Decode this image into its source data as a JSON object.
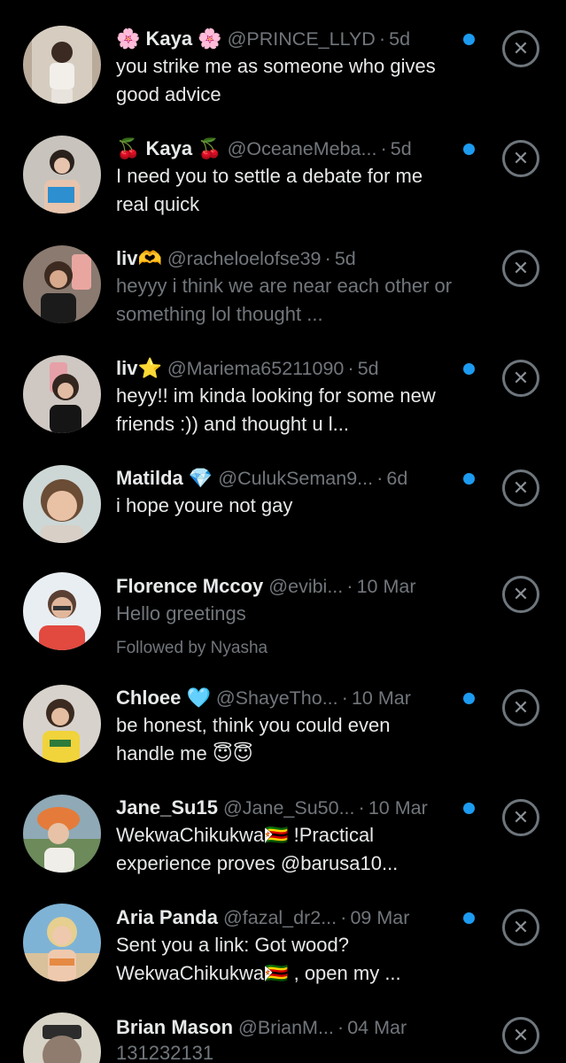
{
  "conversations": [
    {
      "name": "🌸 Kaya 🌸",
      "handle": "@PRINCE_LLYD",
      "time": "5d",
      "message": "you strike me as someone who gives good advice",
      "unread": true
    },
    {
      "name": "🍒 Kaya 🍒",
      "handle": "@OceaneMeba...",
      "time": "5d",
      "message": "I need you to settle a debate for me real quick",
      "unread": true
    },
    {
      "name": "liv🫶",
      "handle": "@racheloelofse39",
      "time": "5d",
      "message": "heyyy i think we are near each other or something lol thought ...",
      "unread": false
    },
    {
      "name": "liv⭐",
      "handle": "@Mariema65211090",
      "time": "5d",
      "message": "heyy!! im kinda looking for some new friends :)) and thought u l...",
      "unread": true
    },
    {
      "name": "Matilda 💎",
      "handle": "@CulukSeman9...",
      "time": "6d",
      "message": "i hope youre not gay",
      "unread": true
    },
    {
      "name": "Florence Mccoy",
      "handle": "@evibi...",
      "time": "10 Mar",
      "message": "Hello greetings",
      "followed_by": "Followed by Nyasha",
      "unread": false
    },
    {
      "name": "Chloee 🩵",
      "handle": "@ShayeTho...",
      "time": "10 Mar",
      "message": "be honest, think you could even handle me 😇😇",
      "unread": true
    },
    {
      "name": "Jane_Su15",
      "handle": "@Jane_Su50...",
      "time": "10 Mar",
      "message": "WekwaChikukwa🇿🇼 !Practical experience proves @barusa10...",
      "unread": true
    },
    {
      "name": "Aria Panda",
      "handle": "@fazal_dr2...",
      "time": "09 Mar",
      "message": "Sent you a link: Got wood? WekwaChikukwa🇿🇼 , open my ...",
      "unread": true
    },
    {
      "name": "Brian Mason",
      "handle": "@BrianM...",
      "time": "04 Mar",
      "message": "131232131",
      "unread": false
    }
  ],
  "icons": {
    "close": "close-circle-icon",
    "unread": "unread-dot-icon"
  },
  "colors": {
    "unread_dot": "#1d9bf0",
    "muted": "#71767b",
    "background": "#000000"
  }
}
